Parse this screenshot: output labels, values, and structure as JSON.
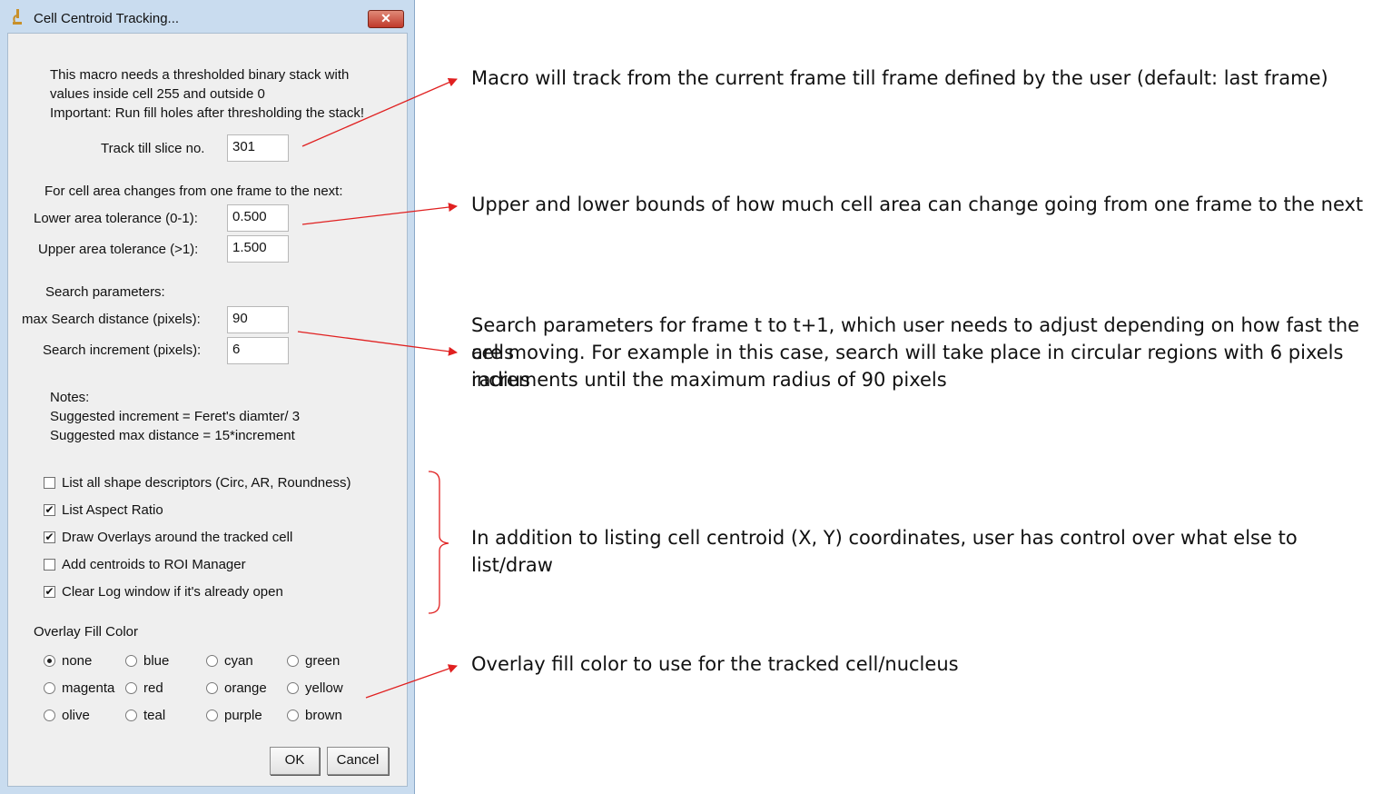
{
  "dialog": {
    "title": "Cell Centroid Tracking...",
    "close_label": "✕",
    "intro_lines": [
      "This macro needs a thresholded binary stack with",
      "values inside cell 255 and outside 0",
      "Important: Run fill holes after thresholding the stack!"
    ],
    "track_label": "Track till slice no.",
    "track_value": "301",
    "area_heading": "For cell area changes from one frame to the next:",
    "lower_label": "Lower area tolerance (0-1):",
    "lower_value": "0.500",
    "upper_label": "Upper area tolerance (>1):",
    "upper_value": "1.500",
    "search_heading": "Search parameters:",
    "max_search_label": "max Search distance (pixels):",
    "max_search_value": "90",
    "increment_label": "Search increment (pixels):",
    "increment_value": "6",
    "notes_lines": [
      "Notes:",
      "Suggested increment = Feret's diamter/ 3",
      "Suggested max distance = 15*increment"
    ],
    "checkboxes": [
      {
        "label": "List all shape descriptors (Circ, AR, Roundness)",
        "checked": false
      },
      {
        "label": "List Aspect Ratio",
        "checked": true
      },
      {
        "label": "Draw Overlays around the tracked cell",
        "checked": true
      },
      {
        "label": "Add centroids to ROI Manager",
        "checked": false
      },
      {
        "label": "Clear Log window if it's already open",
        "checked": true
      }
    ],
    "overlay_heading": "Overlay Fill Color",
    "colors": [
      "none",
      "blue",
      "cyan",
      "green",
      "magenta",
      "red",
      "orange",
      "yellow",
      "olive",
      "teal",
      "purple",
      "brown"
    ],
    "selected_color": "none",
    "ok_label": "OK",
    "cancel_label": "Cancel"
  },
  "annotations": [
    "Macro will track from the current frame till frame defined by the user (default: last frame)",
    "Upper and lower bounds of how much cell area can change going from one frame to the next",
    "Search parameters for frame t to t+1, which user needs to adjust depending on how fast the cells",
    "are moving. For example in this case, search will take place in circular regions with 6 pixels radius",
    "increments until the maximum radius of 90 pixels",
    "In addition to listing cell centroid (X, Y) coordinates, user has control over what else to list/draw",
    "Overlay fill color to use for the tracked cell/nucleus"
  ],
  "colors": {
    "arrow": "#e02020",
    "window_frame": "#c9dcef",
    "close_button": "#c0392b"
  }
}
